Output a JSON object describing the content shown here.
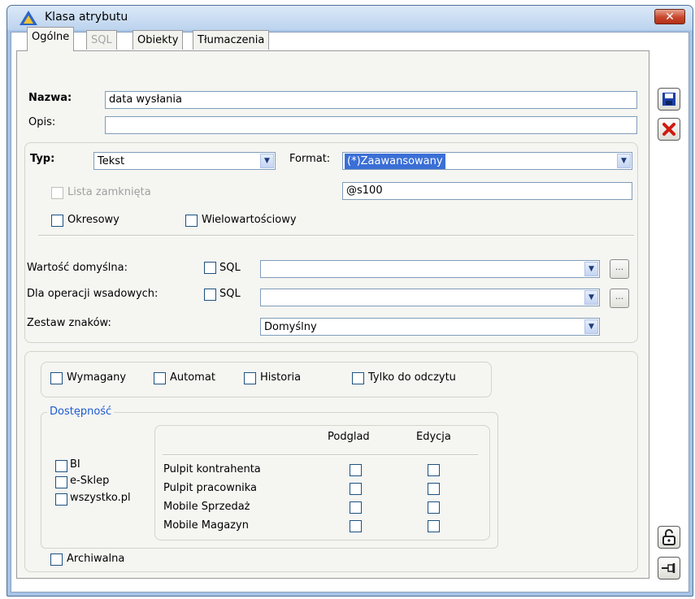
{
  "window": {
    "title": "Klasa atrybutu"
  },
  "tabs": [
    {
      "label": "Ogólne",
      "active": true
    },
    {
      "label": "SQL",
      "disabled": true
    },
    {
      "label": "Obiekty"
    },
    {
      "label": "Tłumaczenia"
    }
  ],
  "general": {
    "name_label": "Nazwa:",
    "name_value": "data wysłania",
    "desc_label": "Opis:",
    "desc_value": ""
  },
  "type_section": {
    "type_label": "Typ:",
    "type_value": "Tekst",
    "format_label": "Format:",
    "format_value": "(*)Zaawansowany",
    "closed_list_label": "Lista zamknięta",
    "format_mask_value": "@s100",
    "periodic_label": "Okresowy",
    "multivalue_label": "Wielowartościowy",
    "default_value_label": "Wartość domyślna:",
    "batch_label": "Dla operacji wsadowych:",
    "sql_label": "SQL",
    "charset_label": "Zestaw znaków:",
    "charset_value": "Domyślny",
    "dots_label": "..."
  },
  "flags": {
    "required_label": "Wymagany",
    "auto_label": "Automat",
    "history_label": "Historia",
    "readonly_label": "Tylko do odczytu"
  },
  "availability": {
    "legend": "Dostępność",
    "apps": [
      "BI",
      "e-Sklep",
      "wszystko.pl"
    ],
    "columns": [
      "Podglad",
      "Edycja"
    ],
    "rows": [
      "Pulpit kontrahenta",
      "Pulpit pracownika",
      "Mobile Sprzedaż",
      "Mobile Magazyn"
    ]
  },
  "archival_label": "Archiwalna",
  "colors": {
    "accent": "#1d5bd0",
    "selection": "#3b6fd6",
    "close": "#c8462c"
  }
}
